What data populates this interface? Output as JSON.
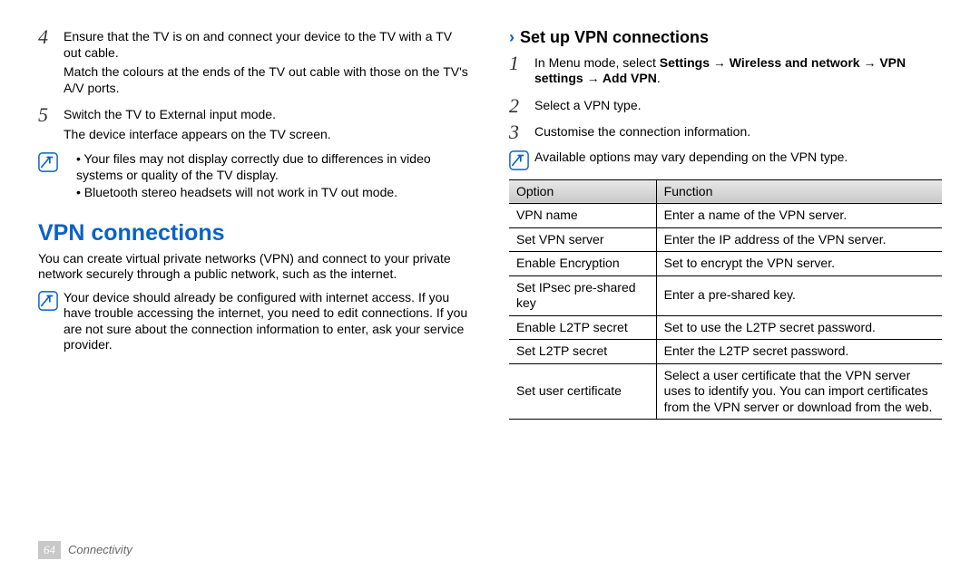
{
  "left": {
    "steps": [
      {
        "num": "4",
        "paras": [
          "Ensure that the TV is on and connect your device to the TV with a TV out cable.",
          "Match the colours at the ends of the TV out cable with those on the TV's A/V ports."
        ]
      },
      {
        "num": "5",
        "paras": [
          "Switch the TV to External input mode.",
          "The device interface appears on the TV screen."
        ]
      }
    ],
    "note_a": {
      "bullets": [
        "Your files may not display correctly due to differences in video systems or quality of the TV display.",
        "Bluetooth stereo headsets will not work in TV out mode."
      ]
    },
    "section_title": "VPN connections",
    "intro": "You can create virtual private networks (VPN) and connect to your private network securely through a public network, such as the internet.",
    "note_b": {
      "text": "Your device should already be configured with internet access. If you have trouble accessing the internet, you need to edit connections. If you are not sure about the connection information to enter, ask your service provider."
    }
  },
  "right": {
    "subhead": "Set up VPN connections",
    "steps": [
      {
        "num": "1",
        "pre": "In Menu mode, select ",
        "bold": "Settings → Wireless and network → VPN settings → Add VPN",
        "post": "."
      },
      {
        "num": "2",
        "plain": "Select a VPN type."
      },
      {
        "num": "3",
        "plain": "Customise the connection information."
      }
    ],
    "note": {
      "text": "Available options may vary depending on the VPN type."
    },
    "table": {
      "h1": "Option",
      "h2": "Function",
      "rows": [
        {
          "o": "VPN name",
          "f": "Enter a name of the VPN server."
        },
        {
          "o": "Set VPN server",
          "f": "Enter the IP address of the VPN server."
        },
        {
          "o": "Enable Encryption",
          "f": "Set to encrypt the VPN server."
        },
        {
          "o": "Set IPsec pre-shared key",
          "f": "Enter a pre-shared key."
        },
        {
          "o": "Enable L2TP secret",
          "f": "Set to use the L2TP secret password."
        },
        {
          "o": "Set L2TP secret",
          "f": "Enter the L2TP secret password."
        },
        {
          "o": "Set user certificate",
          "f": "Select a user certificate that the VPN server uses to identify you. You can import certificates from the VPN server or download from the web."
        }
      ]
    }
  },
  "footer": {
    "page": "64",
    "label": "Connectivity"
  }
}
